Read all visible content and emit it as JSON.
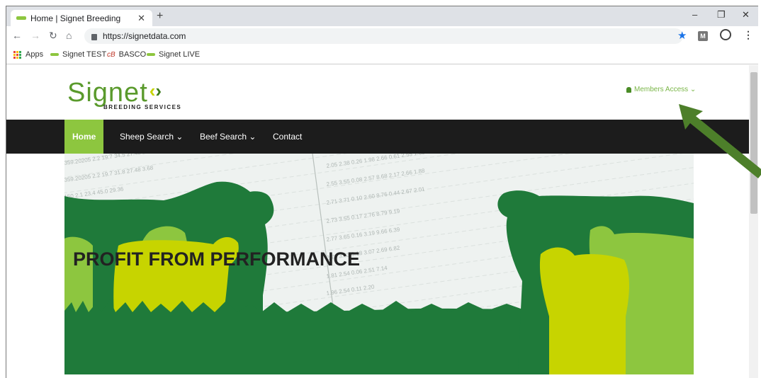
{
  "browser": {
    "tab_title": "Home | Signet Breeding",
    "url": "https://signetdata.com",
    "bookmarks": [
      "Apps",
      "Signet TEST",
      "BASCO",
      "Signet LIVE"
    ],
    "extension_label": "M",
    "win_controls": [
      "–",
      "❐",
      "✕"
    ]
  },
  "site": {
    "logo_word": "Signet",
    "logo_sub": "BREEDING SERVICES",
    "members_access": "Members Access ⌄",
    "nav": [
      {
        "label": "Home",
        "active": true
      },
      {
        "label": "Sheep Search ⌄",
        "active": false
      },
      {
        "label": "Beef Search ⌄",
        "active": false
      },
      {
        "label": "Contact",
        "active": false
      }
    ],
    "hero_headline": "PROFIT FROM PERFORMANCE"
  },
  "colors": {
    "brand_green": "#8dc63f",
    "dark_green": "#1f7a3a",
    "lime": "#c7d400",
    "menubar": "#1c1c1c",
    "arrow": "#4d7f2a"
  }
}
